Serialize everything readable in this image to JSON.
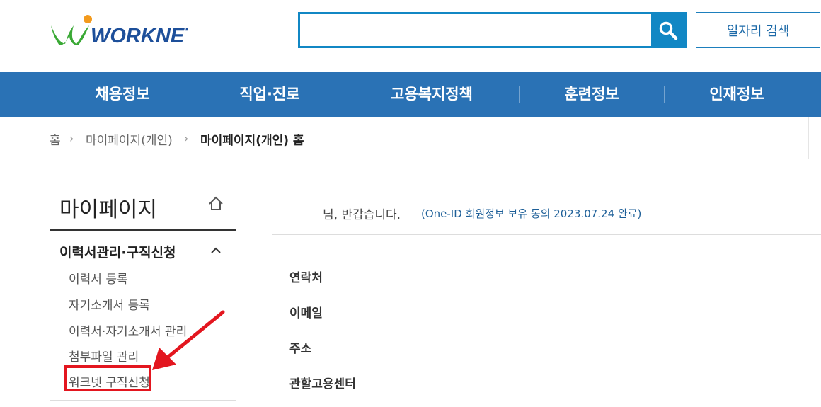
{
  "header": {
    "logo_text": "WORKNET",
    "search_placeholder": "",
    "job_search_label": "일자리 검색"
  },
  "gnb": {
    "items": [
      {
        "label": "채용정보"
      },
      {
        "label": "직업·진로"
      },
      {
        "label": "고용복지정책"
      },
      {
        "label": "훈련정보"
      },
      {
        "label": "인재정보"
      }
    ]
  },
  "breadcrumb": {
    "home": "홈",
    "level1": "마이페이지(개인)",
    "current": "마이페이지(개인) 홈"
  },
  "sidebar": {
    "title": "마이페이지",
    "group_title": "이력서관리·구직신청",
    "items": [
      {
        "label": "이력서 등록"
      },
      {
        "label": "자기소개서 등록"
      },
      {
        "label": "이력서·자기소개서 관리"
      },
      {
        "label": "첨부파일 관리"
      },
      {
        "label": "워크넷 구직신청"
      }
    ]
  },
  "main": {
    "welcome": "님, 반갑습니다.",
    "welcome_note": "(One-ID 회원정보 보유 동의 2023.07.24 완료)",
    "fields": [
      {
        "label": "연락처"
      },
      {
        "label": "이메일"
      },
      {
        "label": "주소"
      },
      {
        "label": "관할고용센터"
      }
    ]
  },
  "colors": {
    "brand_blue": "#2a72b5",
    "search_blue": "#1187c4",
    "annotation_red": "#e3161f",
    "logo_green": "#3aa935",
    "logo_orange": "#f39a1c"
  }
}
